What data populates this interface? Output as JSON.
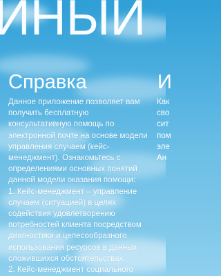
{
  "panorama": {
    "title": "ИНЫЙ"
  },
  "sections": [
    {
      "title": "Справка",
      "body": "Данное приложение позволяет вам\nполучить бесплатную\nконсультативную помощь по\nэлектронной почте на основе модели\nуправления случаем (кейс-\nменеджмент). Ознакомьтесь с\nопределениями основных понятий\nданной модели оказания помощи:\n    1. Кейс-менеджмент – управление\nслучаем (ситуацией) в целях\nсодействия удовлетворению\nпотребностей клиента посредством\nдиагностики и целесообразного\nиспользования ресурсов в данных\nсложившихся обстоятельствах.\n    2. Кейс-менеджмент социального"
    },
    {
      "title": "И",
      "body": "Как\nсво\nсит\nпом\nэле\nАн"
    }
  ]
}
